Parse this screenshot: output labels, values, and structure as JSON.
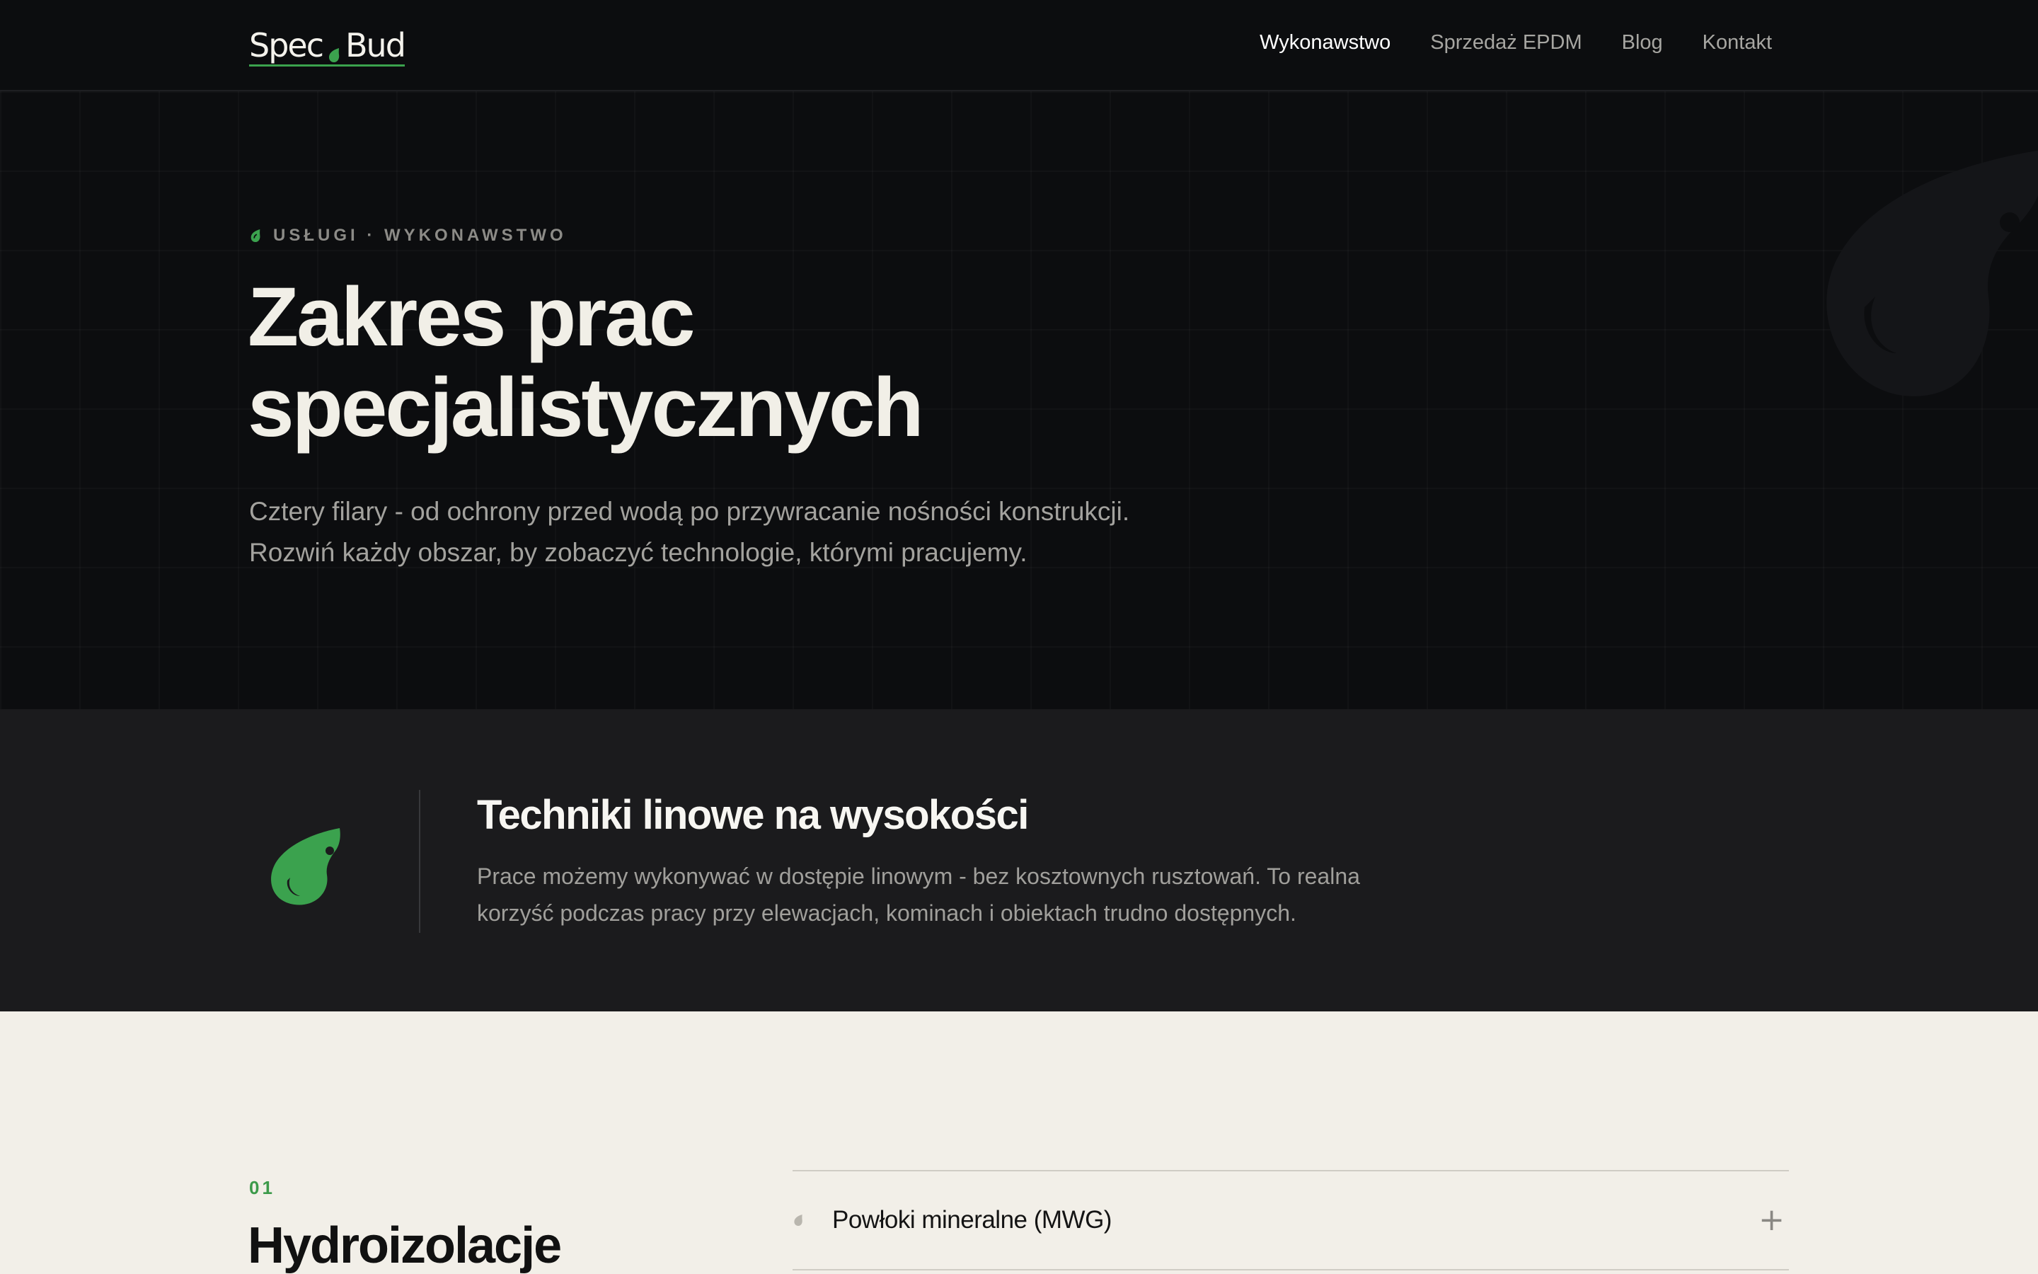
{
  "brand": {
    "left": "Spec",
    "right": "Bud",
    "accent": "#3ba24e"
  },
  "nav": {
    "items": [
      {
        "label": "Wykonawstwo",
        "active": true
      },
      {
        "label": "Sprzedaż EPDM",
        "active": false
      },
      {
        "label": "Blog",
        "active": false
      },
      {
        "label": "Kontakt",
        "active": false
      }
    ]
  },
  "hero": {
    "eyebrow": "USŁUGI · WYKONAWSTWO",
    "title_line1": "Zakres prac",
    "title_line2": "specjalistycznych",
    "subtitle_line1": "Cztery filary - od ochrony przed wodą po przywracanie nośności konstrukcji.",
    "subtitle_line2": "Rozwiń każdy obszar, by zobaczyć technologie, którymi pracujemy."
  },
  "feature": {
    "icon": "drop-leaf-icon",
    "title": "Techniki linowe na wysokości",
    "text_line1": "Prace możemy wykonywać w dostępie linowym - bez kosztownych rusztowań. To realna",
    "text_line2": "korzyść podczas pracy przy elewacjach, kominach i obiektach trudno dostępnych."
  },
  "section": {
    "number": "01",
    "title": "Hydroizolacje",
    "accordion": [
      {
        "label": "Powłoki mineralne (MWG)",
        "expand_icon": "+"
      }
    ]
  },
  "colors": {
    "dark_bg": "#0c0d0f",
    "band_bg": "#1b1b1d",
    "light_bg": "#f2efe8",
    "green": "#3ba24e"
  }
}
